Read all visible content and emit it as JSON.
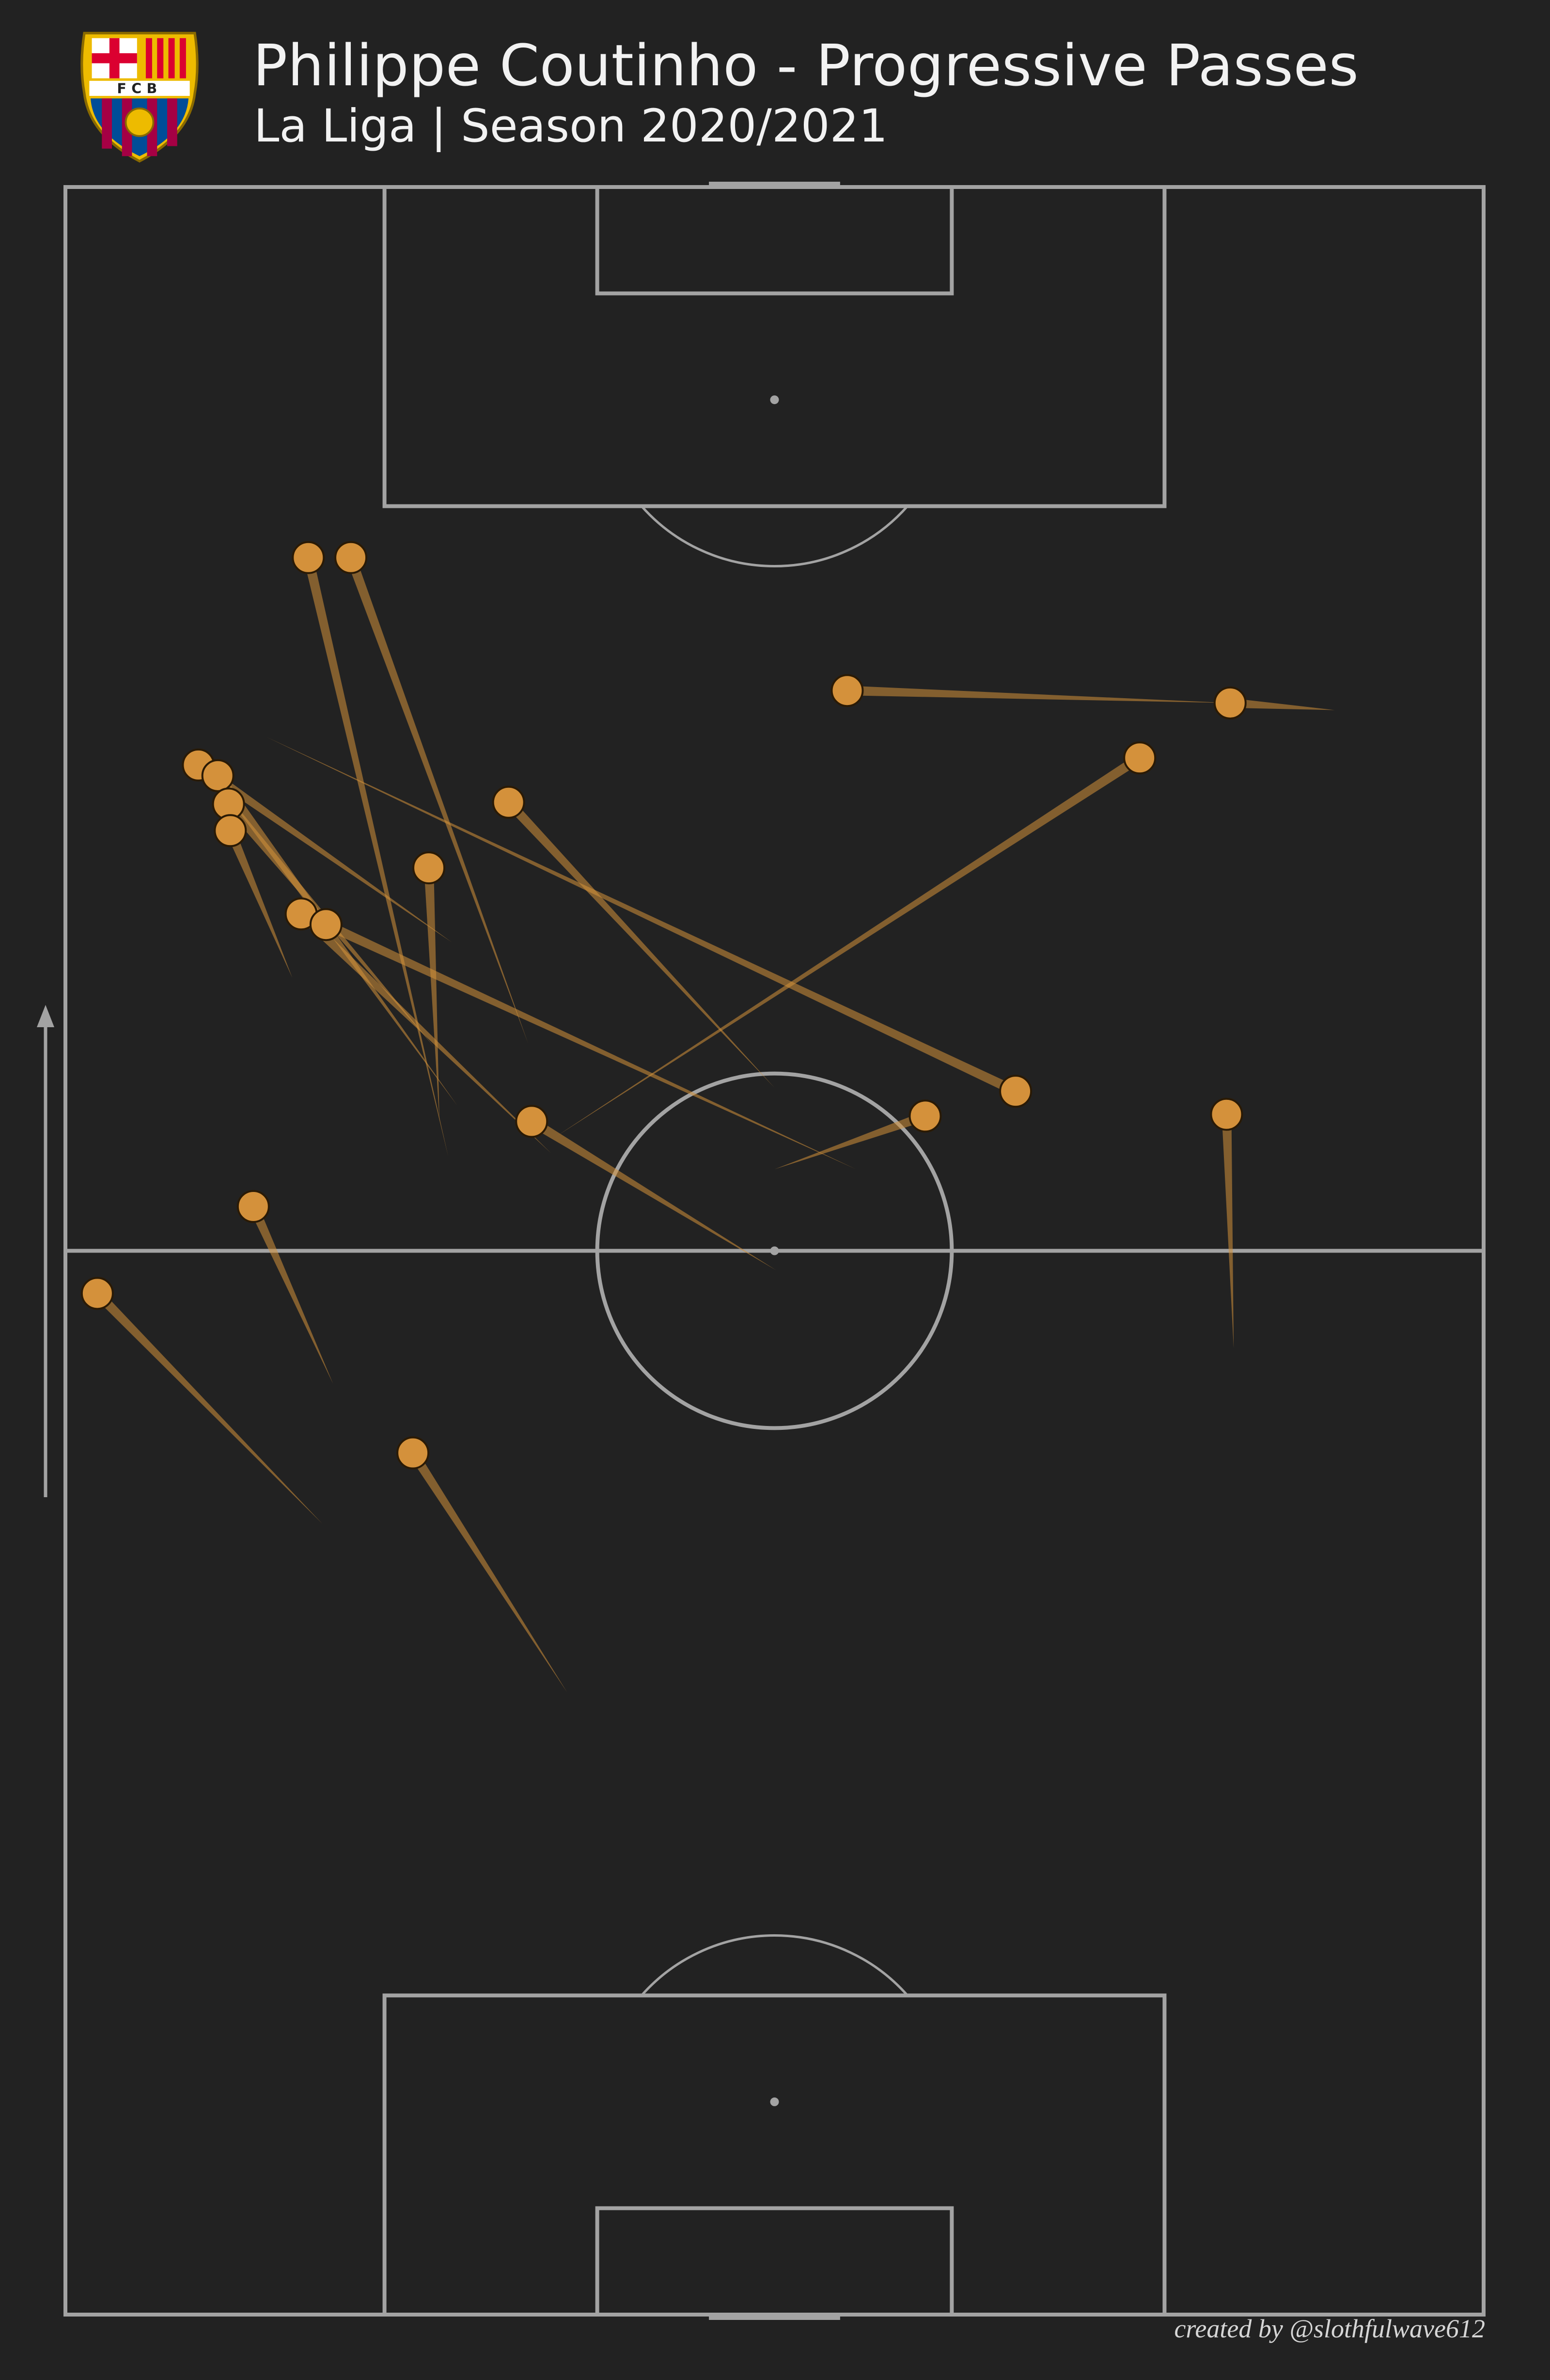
{
  "header": {
    "title": "Philippe Coutinho - Progressive Passes",
    "subtitle": "La Liga | Season 2020/2021",
    "crest_text": "FCB"
  },
  "footer": {
    "credit": "created by @slothfulwave612"
  },
  "colors": {
    "background": "#222222",
    "pitch_lines": "#a3a3a3",
    "pass": "#d4913b",
    "marker_edge": "#2a1a05"
  },
  "direction_arrow": "attacking direction up",
  "chart_data": {
    "type": "scatter",
    "subtype": "pass-map",
    "pitch": {
      "length": 120,
      "width": 80,
      "orientation": "vertical",
      "attack": "up"
    },
    "passes": [
      {
        "start": [
          99.1,
          13.7
        ],
        "end": [
          65.3,
          21.6
        ]
      },
      {
        "start": [
          99.1,
          16.1
        ],
        "end": [
          71.7,
          26.1
        ]
      },
      {
        "start": [
          91.6,
          44.1
        ],
        "end": [
          90.9,
          65.7
        ]
      },
      {
        "start": [
          90.9,
          65.7
        ],
        "end": [
          90.5,
          71.6
        ]
      },
      {
        "start": [
          87.8,
          60.6
        ],
        "end": [
          66.4,
          27.6
        ]
      },
      {
        "start": [
          85.3,
          25.0
        ],
        "end": [
          69.2,
          40.0
        ]
      },
      {
        "start": [
          87.4,
          7.5
        ],
        "end": [
          77.4,
          21.8
        ]
      },
      {
        "start": [
          86.8,
          8.6
        ],
        "end": [
          68.2,
          22.1
        ]
      },
      {
        "start": [
          85.2,
          9.2
        ],
        "end": [
          71.5,
          20.8
        ]
      },
      {
        "start": [
          83.7,
          9.3
        ],
        "end": [
          75.4,
          12.8
        ]
      },
      {
        "start": [
          81.6,
          20.5
        ],
        "end": [
          67.3,
          21.1
        ]
      },
      {
        "start": [
          79.0,
          13.3
        ],
        "end": [
          65.5,
          27.4
        ]
      },
      {
        "start": [
          78.4,
          14.7
        ],
        "end": [
          64.6,
          44.6
        ]
      },
      {
        "start": [
          67.7,
          65.5
        ],
        "end": [
          54.5,
          65.9
        ]
      },
      {
        "start": [
          67.6,
          48.5
        ],
        "end": [
          64.6,
          40.0
        ]
      },
      {
        "start": [
          67.3,
          26.3
        ],
        "end": [
          58.9,
          40.1
        ]
      },
      {
        "start": [
          69.0,
          53.6
        ],
        "end": [
          89.0,
          11.3
        ]
      },
      {
        "start": [
          62.5,
          10.6
        ],
        "end": [
          52.5,
          15.1
        ]
      },
      {
        "start": [
          57.6,
          1.8
        ],
        "end": [
          44.6,
          14.5
        ]
      },
      {
        "start": [
          48.6,
          19.6
        ],
        "end": [
          35.1,
          28.3
        ]
      }
    ],
    "title": "Philippe Coutinho - Progressive Passes",
    "xlabel": "",
    "ylabel": "",
    "grid": false
  }
}
